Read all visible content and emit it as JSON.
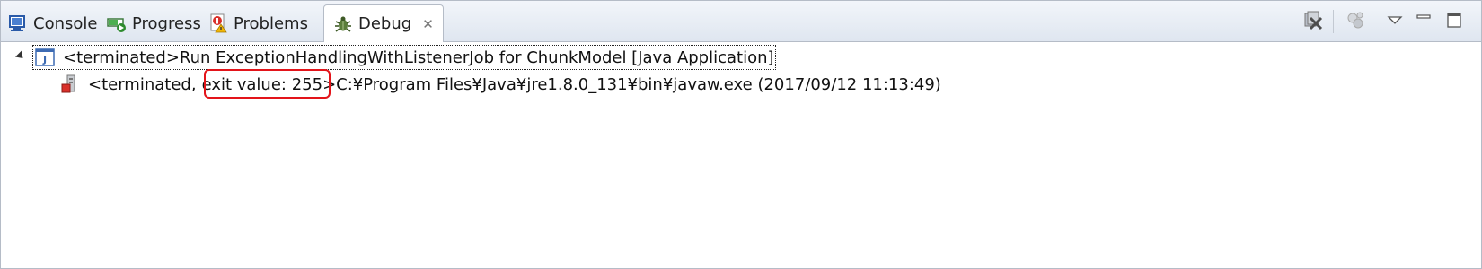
{
  "tabs": [
    {
      "label": "Console",
      "icon": "console-icon"
    },
    {
      "label": "Progress",
      "icon": "progress-icon"
    },
    {
      "label": "Problems",
      "icon": "problems-icon"
    },
    {
      "label": "Debug",
      "icon": "debug-icon",
      "active": true
    }
  ],
  "toolbar": {
    "icons": [
      "remove-all-terminated-icon",
      "connect-icon",
      "view-menu-icon",
      "minimize-icon",
      "maximize-icon"
    ]
  },
  "tree": {
    "launch": {
      "label": "<terminated>Run ExceptionHandlingWithListenerJob for ChunkModel [Java Application]",
      "icon": "java-application-icon"
    },
    "process": {
      "prefix": "<terminated,",
      "exit_value": "exit value: 255",
      "suffix": ">C:¥Program Files¥Java¥jre1.8.0_131¥bin¥javaw.exe (2017/09/12 11:13:49)",
      "icon": "terminated-process-icon"
    }
  },
  "colors": {
    "highlight": "#e3141a",
    "tab_background": "#dfe6f0",
    "border": "#b5bcc7"
  }
}
